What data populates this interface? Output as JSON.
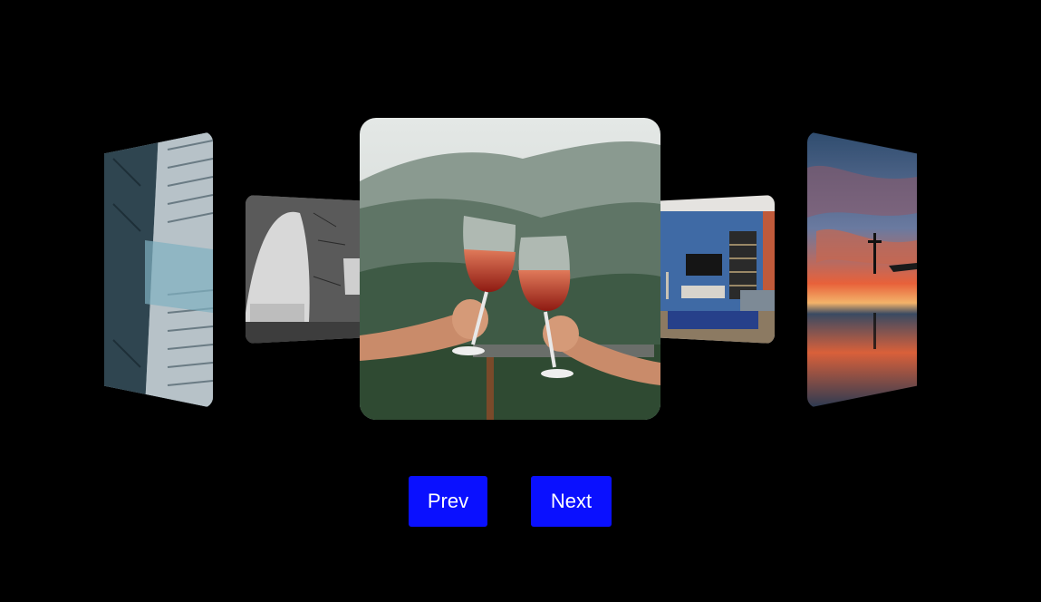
{
  "carousel": {
    "slides": [
      {
        "subject": "architecture",
        "position": "far-left"
      },
      {
        "subject": "cave-view",
        "position": "near-left"
      },
      {
        "subject": "wine-toast",
        "position": "center",
        "active": true
      },
      {
        "subject": "living-room",
        "position": "near-right"
      },
      {
        "subject": "sunset-lake",
        "position": "far-right"
      }
    ]
  },
  "controls": {
    "prev_label": "Prev",
    "next_label": "Next"
  },
  "colors": {
    "background": "#000000",
    "button": "#0a10ff",
    "button_text": "#ffffff"
  }
}
